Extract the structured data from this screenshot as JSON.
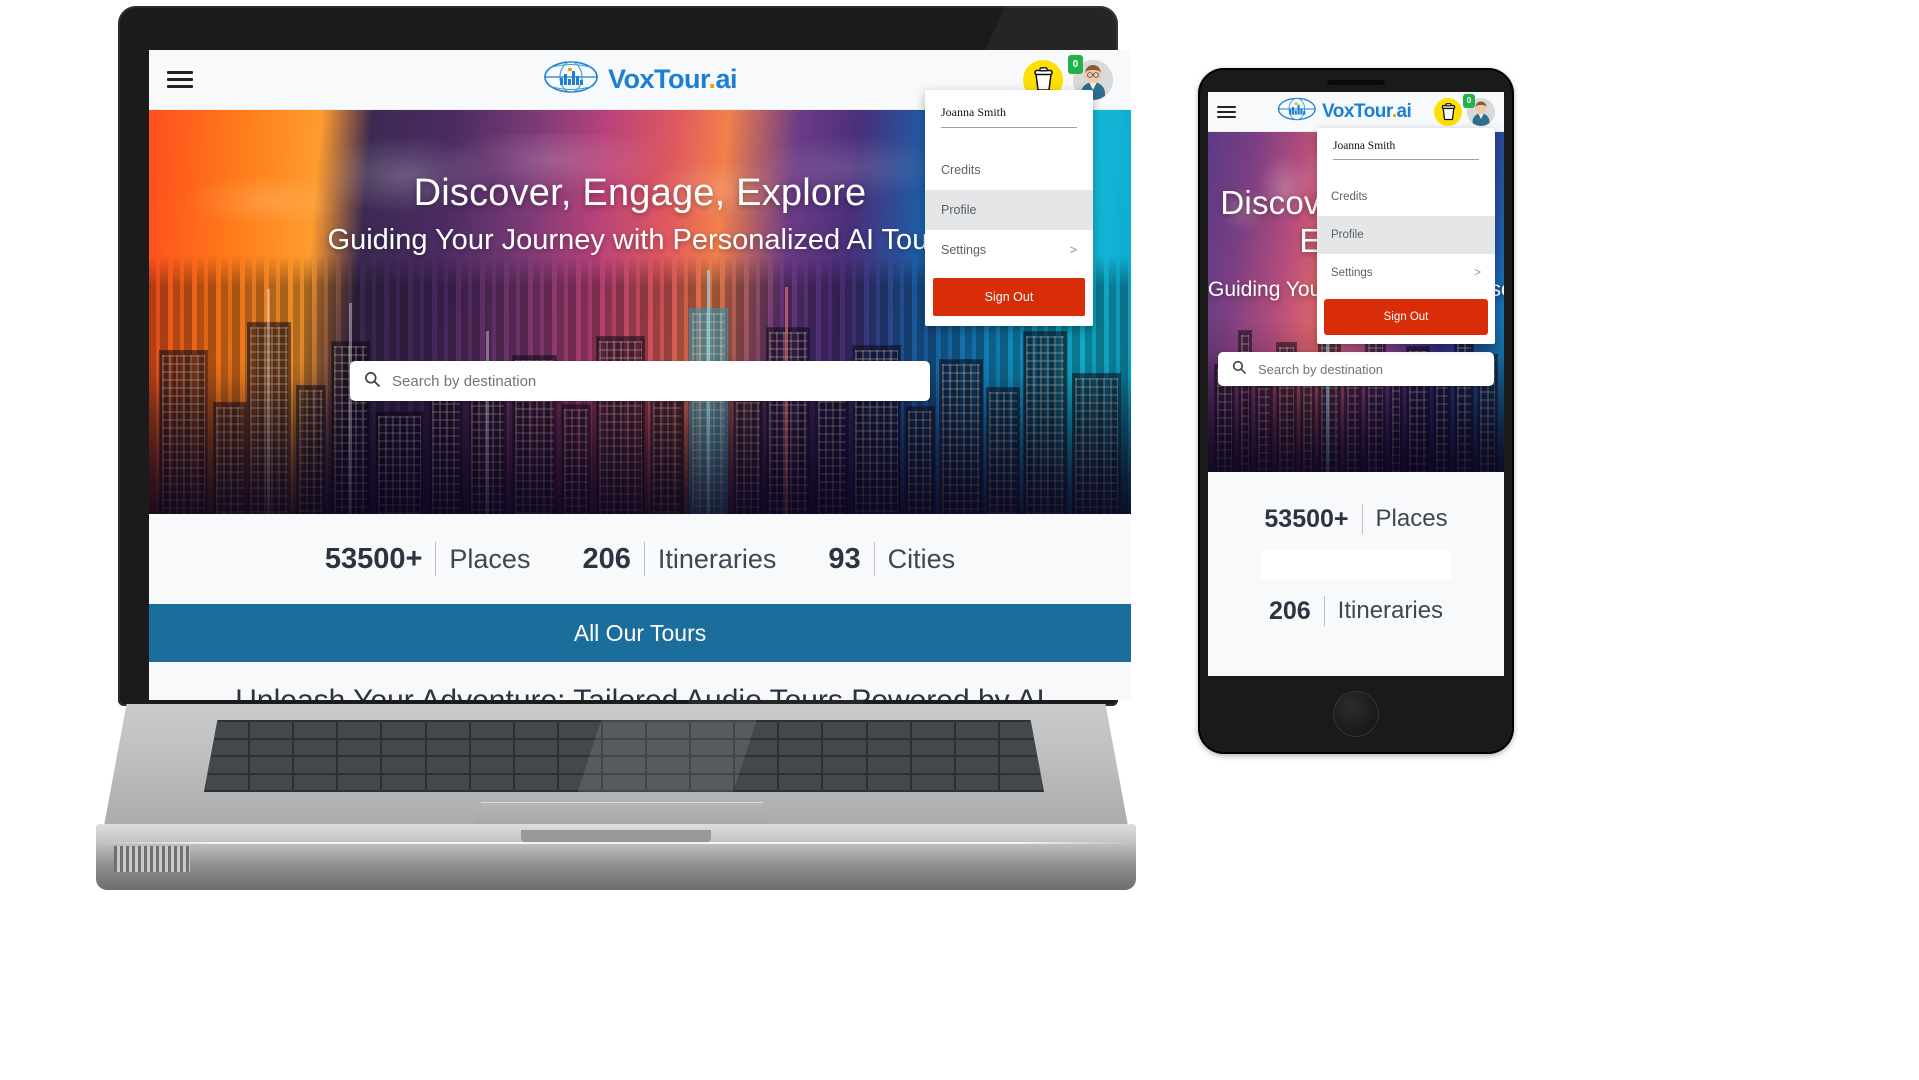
{
  "brand": {
    "name_part1": "Vox",
    "name_part2": "Tour",
    "dot": ".",
    "name_part3": "ai",
    "full": "VoxTour.ai",
    "logo_icon": "globe-equalizer-icon",
    "primary_color": "#1b7fd4",
    "dot_color": "#f0a400"
  },
  "appbar": {
    "menu_icon": "hamburger-menu-icon",
    "credits_icon": "coffee-cup-icon",
    "credits_badge": "0",
    "avatar_icon": "user-avatar",
    "badge_color": "#21b24b",
    "cup_bg_color": "#FFE000"
  },
  "hero": {
    "title": "Discover, Engage, Explore",
    "subtitle": "Guiding Your Journey with Personalized AI Tours",
    "background": "city-skyline-sunset-illustration"
  },
  "search": {
    "icon": "search-icon",
    "placeholder": "Search by destination",
    "value": ""
  },
  "stats": [
    {
      "number": "53500+",
      "label": "Places"
    },
    {
      "number": "206",
      "label": "Itineraries"
    },
    {
      "number": "93",
      "label": "Cities"
    }
  ],
  "tours_bar": {
    "label": "All Our Tours",
    "bg_color": "#1b6e9b"
  },
  "section": {
    "heading": "Unleash Your Adventure: Tailored Audio Tours Powered by AI"
  },
  "dropdown": {
    "user_name": "Joanna Smith",
    "items": [
      {
        "label": "Credits",
        "active": false,
        "chevron": ""
      },
      {
        "label": "Profile",
        "active": true,
        "chevron": ""
      },
      {
        "label": "Settings",
        "active": false,
        "chevron": ">"
      }
    ],
    "sign_out": "Sign Out",
    "sign_out_color": "#d92c08",
    "active_row_color": "#e4e6e7"
  },
  "devices": {
    "laptop": "laptop-mockup",
    "phone": "phone-mockup"
  }
}
